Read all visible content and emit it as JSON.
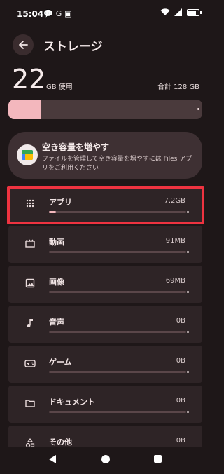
{
  "status": {
    "time": "15:04",
    "left_icons": [
      "💬",
      "G",
      "▣"
    ]
  },
  "header": {
    "title": "ストレージ"
  },
  "summary": {
    "used_value": "22",
    "used_unit": "GB 使用",
    "total_text": "合計 128 GB",
    "used_fraction": 0.17
  },
  "free_space_card": {
    "title": "空き容量を増やす",
    "description": "ファイルを管理して空き容量を増やすには Files アプリをご利用ください"
  },
  "categories": [
    {
      "label": "アプリ",
      "size": "7.2GB",
      "fraction": 0.05,
      "icon": "apps-grid-icon"
    },
    {
      "label": "動画",
      "size": "91MB",
      "fraction": 0.0,
      "icon": "movie-icon"
    },
    {
      "label": "画像",
      "size": "69MB",
      "fraction": 0.0,
      "icon": "image-icon"
    },
    {
      "label": "音声",
      "size": "0B",
      "fraction": 0.0,
      "icon": "music-note-icon"
    },
    {
      "label": "ゲーム",
      "size": "0B",
      "fraction": 0.0,
      "icon": "gamepad-icon"
    },
    {
      "label": "ドキュメント",
      "size": "0B",
      "fraction": 0.0,
      "icon": "folder-icon"
    },
    {
      "label": "その他",
      "size": "0B",
      "fraction": 0.0,
      "icon": "shapes-icon"
    }
  ],
  "colors": {
    "accent": "#f3b7bd",
    "highlight": "#ee3340",
    "background": "#1e1718"
  }
}
